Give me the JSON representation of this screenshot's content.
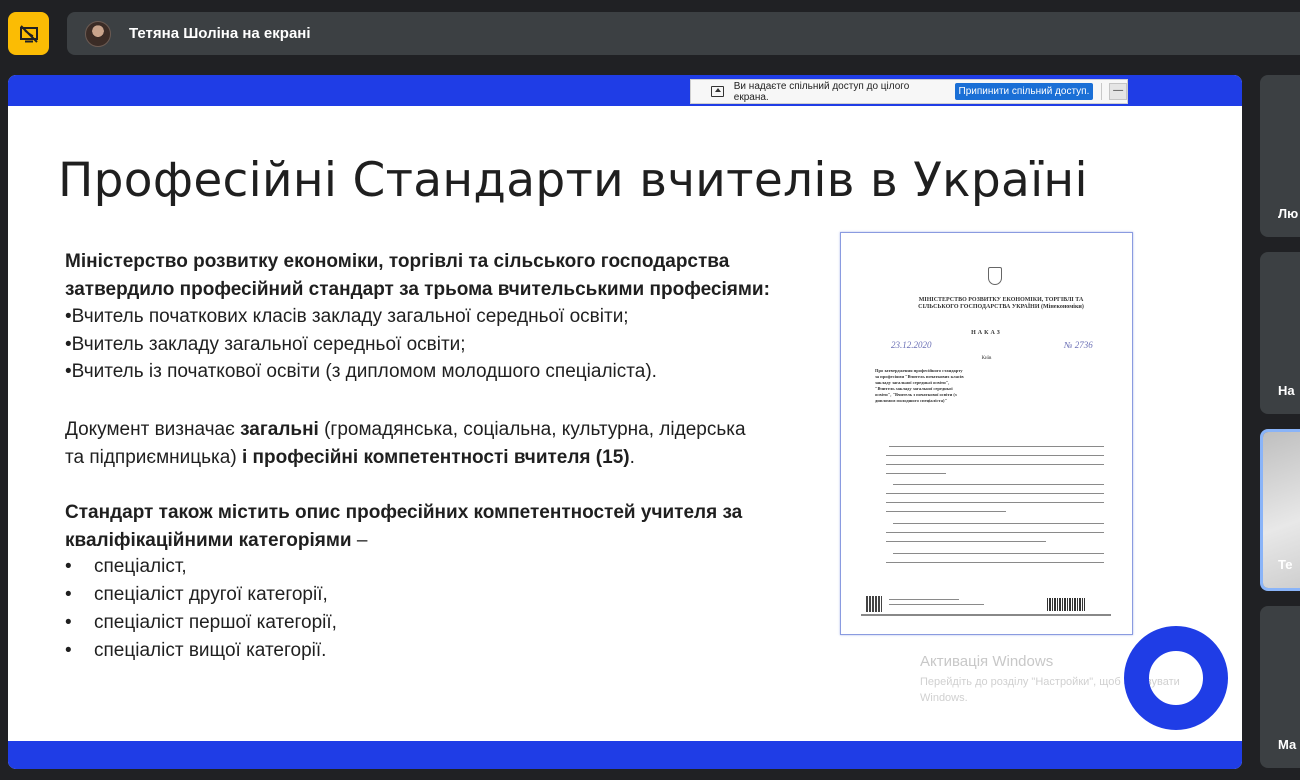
{
  "presenter": {
    "name": "Тетяна Шоліна на екрані"
  },
  "share_notice": {
    "text": "Ви надаєте спільний доступ до цілого екрана.",
    "stop_label": "Припинити спільний доступ.",
    "minimize_label": "—"
  },
  "slide": {
    "title": "Професійні Стандарти вчителів в Україні",
    "intro_line1": "Міністерство розвитку економіки, торгівлі та сільського господарства",
    "intro_line2": "затвердило професійний стандарт за трьома вчительськими професіями:",
    "professions": [
      "•Вчитель початкових класів закладу загальної середньої освіти;",
      "•Вчитель закладу загальної середньої освіти;",
      "•Вчитель із початкової освіти (з дипломом молодшого спеціаліста)."
    ],
    "doc_text_1a": "Документ визначає ",
    "doc_text_1b": "загальні",
    "doc_text_1c": " (громадянська, соціальна, культурна, лідерська",
    "doc_text_2a": "та підприємницька) ",
    "doc_text_2b": "і професійні компетентності вчителя (15)",
    "doc_text_2c": ".",
    "standard_line1": "Стандарт також містить опис професійних компетентностей учителя за",
    "standard_line2a": "кваліфікаційними категоріями",
    "standard_line2b": " –",
    "categories": [
      "спеціаліст,",
      "спеціаліст другої категорії,",
      "спеціаліст першої категорії,",
      "спеціаліст вищої категорії."
    ],
    "bullet_symbol": "•"
  },
  "document_image": {
    "ministry": "МІНІСТЕРСТВО РОЗВИТКУ ЕКОНОМІКИ, ТОРГІВЛІ ТА СІЛЬСЬКОГО ГОСПОДАРСТВА УКРАЇНИ (Мінекономіки)",
    "order": "НАКАЗ",
    "date": "23.12.2020",
    "number": "№ 2736",
    "city": "Київ",
    "subject": "Про затвердження професійного стандарту за професіями \"Вчитель початкових класів закладу загальної середньої освіти\", \"Вчитель закладу загальної середньої освіти\", \"Вчитель з початкової освіти (з дипломом молодшого спеціаліста)\""
  },
  "activation": {
    "title": "Активація Windows",
    "subtitle_line1": "Перейдіть до розділу \"Настройки\", щоб активувати",
    "subtitle_line2": "Windows."
  },
  "participants": [
    {
      "name": "Лю"
    },
    {
      "name": "На"
    },
    {
      "name": "Те"
    },
    {
      "name": "Ма"
    }
  ],
  "colors": {
    "accent_blue": "#1f3de6",
    "present_yellow": "#fbbc04",
    "stop_button": "#1a6fd6"
  }
}
